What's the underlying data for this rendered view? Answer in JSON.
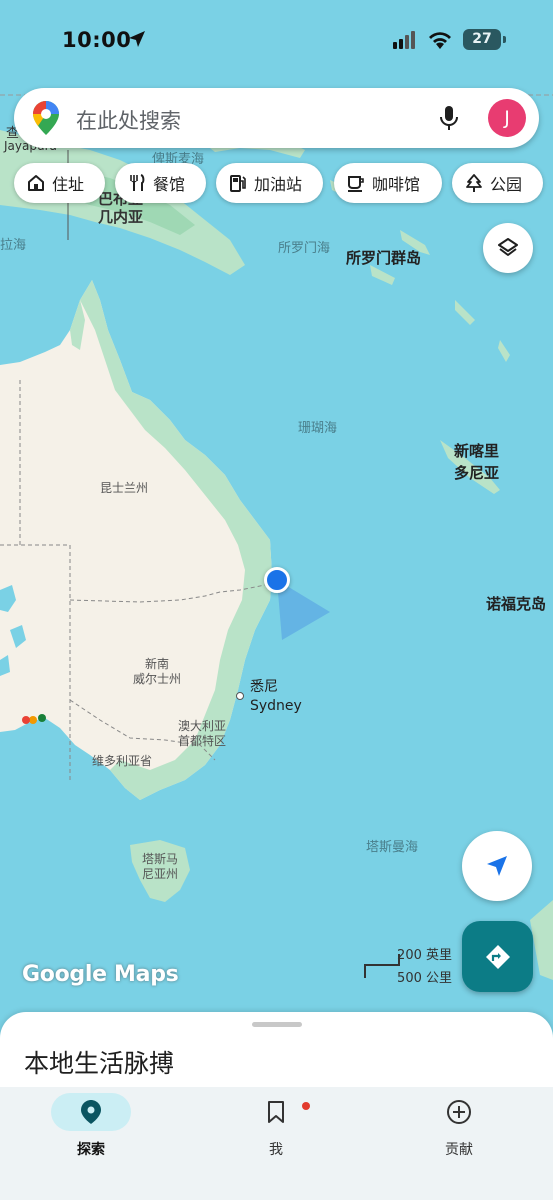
{
  "status_bar": {
    "time": "10:00",
    "battery": "27"
  },
  "search": {
    "placeholder": "在此处搜索",
    "avatar_letter": "J"
  },
  "chips": [
    {
      "label": "住址",
      "icon": "home-icon"
    },
    {
      "label": "餐馆",
      "icon": "restaurant-icon"
    },
    {
      "label": "加油站",
      "icon": "gas-station-icon"
    },
    {
      "label": "咖啡馆",
      "icon": "coffee-icon"
    },
    {
      "label": "公园",
      "icon": "park-icon"
    }
  ],
  "map": {
    "labels": {
      "jayapura_cn": "查",
      "jayapura": "Jayapura",
      "bismarck_sea": "俾斯麦海",
      "png_partial": "巴布亚",
      "png_line2": "几内亚",
      "arafura_partial": "拉海",
      "solomon_sea": "所罗门海",
      "solomon_islands": "所罗门群岛",
      "coral_sea": "珊瑚海",
      "new_caledonia_1": "新喀里",
      "new_caledonia_2": "多尼亚",
      "queensland": "昆士兰州",
      "norfolk": "诺福克岛",
      "nsw_1": "新南",
      "nsw_2": "威尔士州",
      "sydney_cn": "悉尼",
      "sydney_en": "Sydney",
      "act_1": "澳大利亚",
      "act_2": "首都特区",
      "victoria": "维多利亚省",
      "tasman_sea": "塔斯曼海",
      "tasmania_1": "塔斯马",
      "tasmania_2": "尼亚州"
    },
    "logo": "Google Maps",
    "scale_imperial": "200 英里",
    "scale_metric": "500 公里",
    "colors": {
      "water": "#7ad1e5",
      "land": "#f5f1e8",
      "vegetation": "#b9e3c8",
      "location_dot": "#1a73e8",
      "directions_button": "#0c7c86"
    }
  },
  "sheet": {
    "title": "本地生活脉搏"
  },
  "nav": {
    "explore": "探索",
    "you": "我",
    "contribute": "贡献"
  }
}
